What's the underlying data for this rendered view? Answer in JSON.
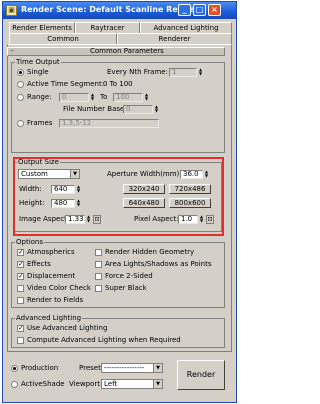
{
  "window": {
    "title": "Render Scene: Default Scanline Rende...",
    "icon": "3ds-max-icon",
    "controls": [
      "minimize",
      "maximize",
      "close"
    ]
  },
  "tabs": {
    "row1": [
      "Render Elements",
      "Raytracer",
      "Advanced Lighting"
    ],
    "row2": [
      "Common",
      "Renderer"
    ],
    "active": "Common"
  },
  "rollout": {
    "toggle": "-",
    "title": "Common Parameters"
  },
  "time_output": {
    "label": "Time Output",
    "single": "Single",
    "every_nth_label": "Every Nth Frame:",
    "every_nth_value": "1",
    "active_segment": "Active Time Segment:",
    "active_segment_range": "0 To 100",
    "range": "Range:",
    "range_from": "0",
    "range_to_label": "To",
    "range_to": "100",
    "file_number_base_label": "File Number Base:",
    "file_number_base_value": "0",
    "frames": "Frames",
    "frames_value": "1,3,5-12"
  },
  "output_size": {
    "label": "Output Size",
    "preset": "Custom",
    "aperture_label": "Aperture Width(mm):",
    "aperture_value": "36.0",
    "width_label": "Width:",
    "width_value": "640",
    "height_label": "Height:",
    "height_value": "480",
    "presets": [
      "320x240",
      "720x486",
      "640x480",
      "800x600"
    ],
    "image_aspect_label": "Image Aspect:",
    "image_aspect_value": "1.333",
    "pixel_aspect_label": "Pixel Aspect:",
    "pixel_aspect_value": "1.0"
  },
  "options": {
    "label": "Options",
    "left": [
      {
        "label": "Atmospherics",
        "checked": true
      },
      {
        "label": "Effects",
        "checked": true
      },
      {
        "label": "Displacement",
        "checked": true
      },
      {
        "label": "Video Color Check",
        "checked": false
      },
      {
        "label": "Render to Fields",
        "checked": false
      }
    ],
    "right": [
      {
        "label": "Render Hidden Geometry",
        "checked": false
      },
      {
        "label": "Area Lights/Shadows as Points",
        "checked": false
      },
      {
        "label": "Force 2-Sided",
        "checked": false
      },
      {
        "label": "Super Black",
        "checked": false
      }
    ]
  },
  "advanced_lighting": {
    "label": "Advanced Lighting",
    "use": "Use Advanced Lighting",
    "use_checked": true,
    "compute": "Compute Advanced Lighting when Required",
    "compute_checked": false
  },
  "bottom": {
    "production": "Production",
    "activeshade": "ActiveShade",
    "preset_label": "Preset:",
    "preset_value": "----------------",
    "viewport_label": "Viewport:",
    "viewport_value": "Left",
    "render_button": "Render"
  }
}
